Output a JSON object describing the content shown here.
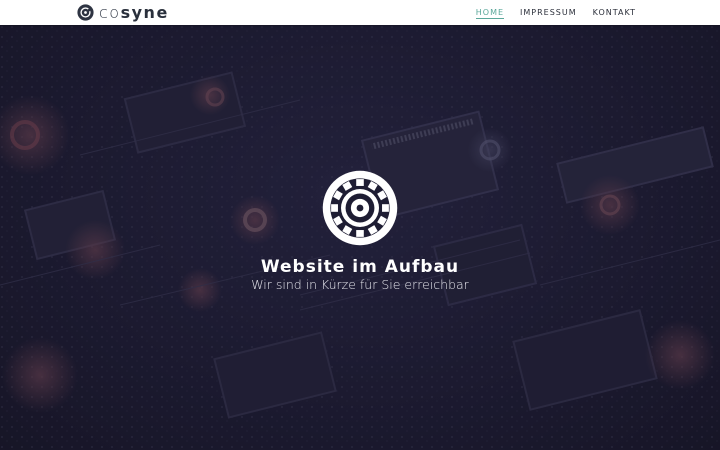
{
  "header": {
    "logo": {
      "icon": "cosyne-logo-icon",
      "text_light": "co",
      "text_bold": "syne"
    },
    "nav": [
      {
        "label": "HOME",
        "active": true
      },
      {
        "label": "IMPRESSUM",
        "active": false
      },
      {
        "label": "KONTAKT",
        "active": false
      }
    ]
  },
  "hero": {
    "emblem_icon": "circuit-gear-emblem-icon",
    "title": "Website im Aufbau",
    "subtitle": "Wir sind in Kürze für Sie erreichbar",
    "background": "circuit-board-photo"
  },
  "colors": {
    "accent": "#5aa79a",
    "header_bg": "#ffffff",
    "hero_bg": "#1c1b30",
    "text_light": "#ffffff"
  }
}
